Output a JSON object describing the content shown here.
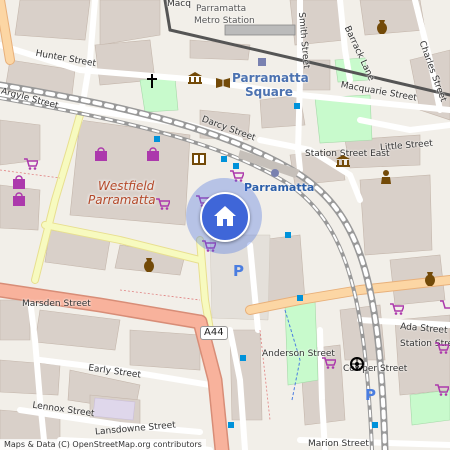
{
  "map": {
    "streets": {
      "hunter": "Hunter Street",
      "argyle": "Argyle Street",
      "darcy": "Darcy Street",
      "macquarie": "Macquarie Street",
      "smith": "Smith Street",
      "barrack": "Barrack Lane",
      "charles": "Charles Street",
      "little": "Little Street",
      "station_east": "Station Street East",
      "marsden": "Marsden Street",
      "early": "Early Street",
      "lennox": "Lennox Street",
      "lansdowne": "Lansdowne Street",
      "anderson": "Anderson Street",
      "cowper": "Cowper Street",
      "ada": "Ada Street",
      "station_east_south": "Station Street East",
      "marion": "Marion Street",
      "macquarie_north": "Macq"
    },
    "places": {
      "westfield": "Westfield\nParramatta",
      "westfield_line1": "Westfield",
      "westfield_line2": "Parramatta",
      "parramatta_square_line1": "Parramatta",
      "parramatta_square_line2": "Square",
      "parramatta_station": "Parramatta",
      "metro_line1": "Parramatta",
      "metro_line2": "Metro Station"
    },
    "route_shield": "A44",
    "attribution": "Maps & Data (C) OpenStreetMap.org contributors",
    "icons": [
      "home-icon",
      "church-icon",
      "shopping-bag-icon",
      "shopping-cart-icon",
      "library-icon",
      "museum-icon",
      "theatre-icon",
      "parking-icon",
      "bus-stop-icon",
      "train-icon",
      "vase-icon",
      "lifeguard-icon",
      "police-icon"
    ],
    "colors": {
      "land": "#f2efe9",
      "building": "#d9d0c9",
      "road_primary": "#fcd6a4",
      "road_trunk": "#f8b29c",
      "road_secondary": "#f7fabf",
      "railway": "#999999",
      "park": "#c8facc",
      "location": "#3f66d8",
      "shop_icon": "#ac39ac",
      "poi_text": "#b44a2b"
    }
  }
}
